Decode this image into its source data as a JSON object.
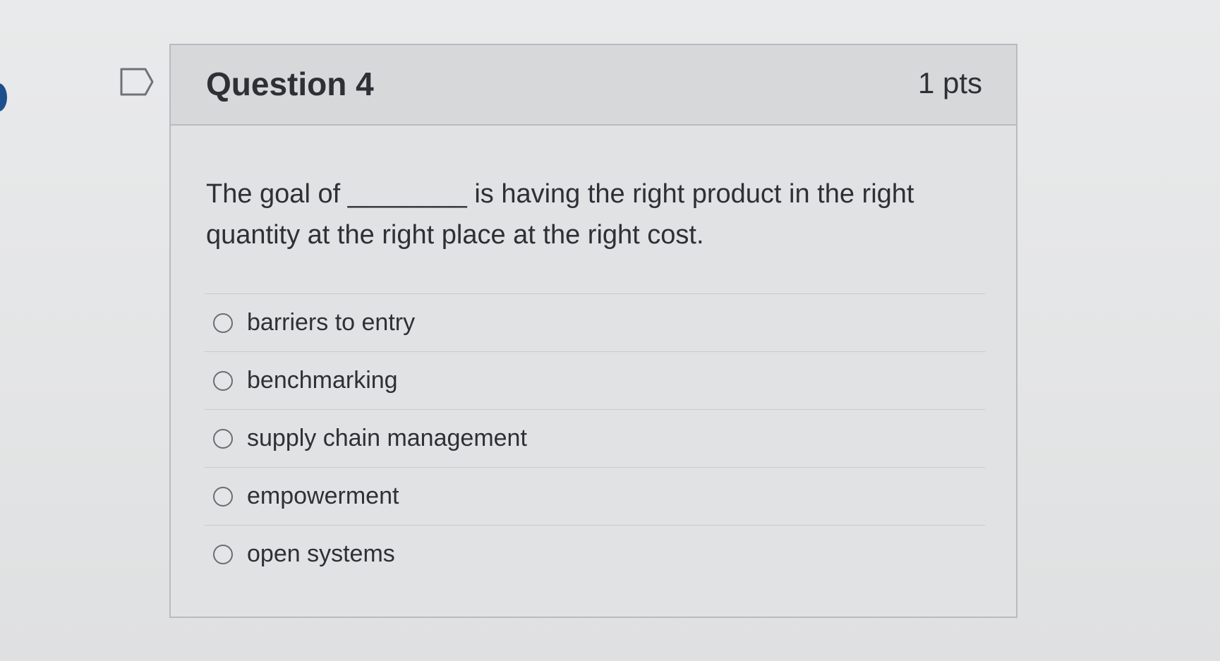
{
  "question": {
    "title": "Question 4",
    "points": "1 pts",
    "text": "The goal of ________ is having the right product in the right quantity at the right place at the right cost."
  },
  "answers": [
    {
      "label": "barriers to entry"
    },
    {
      "label": "benchmarking"
    },
    {
      "label": "supply chain management"
    },
    {
      "label": "empowerment"
    },
    {
      "label": "open systems"
    }
  ],
  "icons": {
    "flag": "flag-question-icon",
    "radio": "radio-unselected-icon"
  },
  "colors": {
    "text": "#2d3035",
    "border": "#b9bbbe",
    "header_bg": "#d7d8da",
    "accent_dot": "#1c4f8c"
  }
}
